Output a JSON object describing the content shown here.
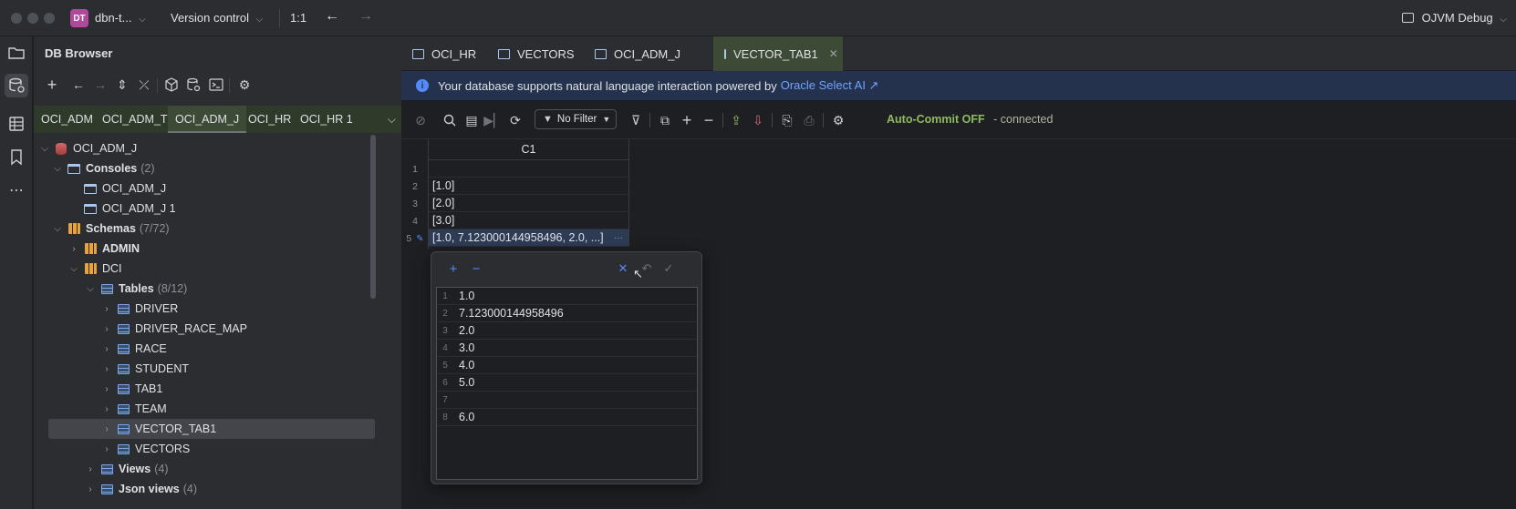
{
  "titlebar": {
    "project_badge": "DT",
    "project_name": "dbn-t...",
    "version_control": "Version control",
    "zoom": "1:1",
    "run_config": "OJVM Debug"
  },
  "db_browser": {
    "title": "DB Browser",
    "connection_tabs": [
      "OCI_ADM",
      "OCI_ADM_T",
      "OCI_ADM_J",
      "OCI_HR",
      "OCI_HR 1"
    ],
    "active_connection": "OCI_ADM_J",
    "tree": {
      "root": "OCI_ADM_J",
      "consoles_label": "Consoles",
      "consoles_count": "(2)",
      "consoles": [
        "OCI_ADM_J",
        "OCI_ADM_J 1"
      ],
      "schemas_label": "Schemas",
      "schemas_count": "(7/72)",
      "schema_admin": "ADMIN",
      "schema_dci": "DCI",
      "tables_label": "Tables",
      "tables_count": "(8/12)",
      "tables": [
        "DRIVER",
        "DRIVER_RACE_MAP",
        "RACE",
        "STUDENT",
        "TAB1",
        "TEAM",
        "VECTOR_TAB1",
        "VECTORS"
      ],
      "selected_table": "VECTOR_TAB1",
      "views_label": "Views",
      "views_count": "(4)",
      "json_views_label": "Json views",
      "json_views_count": "(4)"
    }
  },
  "editor_tabs": [
    "OCI_HR",
    "VECTORS",
    "OCI_ADM_J",
    "VECTOR_TAB1"
  ],
  "active_editor_tab": "VECTOR_TAB1",
  "banner": {
    "text": "Your database supports natural language interaction powered by",
    "link": "Oracle Select AI ↗"
  },
  "data_toolbar": {
    "filter": "No Filter",
    "autocommit": "Auto-Commit OFF",
    "status": "- connected"
  },
  "grid": {
    "column": "C1",
    "rows": [
      {
        "n": "1",
        "v": ""
      },
      {
        "n": "2",
        "v": "[1.0]"
      },
      {
        "n": "3",
        "v": "[2.0]"
      },
      {
        "n": "4",
        "v": "[3.0]"
      },
      {
        "n": "5",
        "v": "[1.0, 7.123000144958496, 2.0, ...]"
      }
    ],
    "more_label": "···"
  },
  "popup_editor": {
    "items": [
      {
        "n": "1",
        "v": "1.0"
      },
      {
        "n": "2",
        "v": "7.123000144958496"
      },
      {
        "n": "3",
        "v": "2.0"
      },
      {
        "n": "4",
        "v": "3.0"
      },
      {
        "n": "5",
        "v": "4.0"
      },
      {
        "n": "6",
        "v": "5.0"
      },
      {
        "n": "7",
        "v": ""
      },
      {
        "n": "8",
        "v": "6.0"
      }
    ]
  },
  "colors": {
    "accent_blue": "#548af7",
    "link": "#6fa3ff",
    "autocommit_green": "#8dbb5e",
    "active_tab_green": "#3d4a35"
  }
}
